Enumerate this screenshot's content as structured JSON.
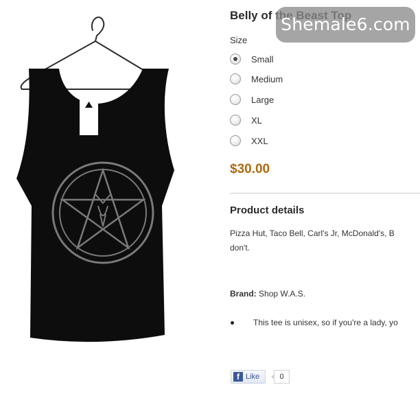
{
  "product": {
    "title": "Belly of the Beast Top",
    "price": "$30.00"
  },
  "watermark": "Shemale6.com",
  "size": {
    "label": "Size",
    "options": [
      {
        "label": "Small",
        "selected": true
      },
      {
        "label": "Medium",
        "selected": false
      },
      {
        "label": "Large",
        "selected": false
      },
      {
        "label": "XL",
        "selected": false
      },
      {
        "label": "XXL",
        "selected": false
      }
    ]
  },
  "details": {
    "heading": "Product details",
    "description_lines": [
      "Pizza Hut, Taco Bell, Carl's Jr, McDonald's, B",
      "don't."
    ],
    "brand_label": "Brand:",
    "brand_value": "Shop W.A.S.",
    "bullets": [
      "This tee is unisex, so if you're a lady, yo"
    ]
  },
  "social": {
    "like_label": "Like",
    "like_icon": "f",
    "like_count": "0"
  },
  "colors": {
    "price": "#b06a10",
    "facebook": "#3b5998",
    "shirt": "#0d0d0d",
    "print": "#7a7a7a"
  }
}
